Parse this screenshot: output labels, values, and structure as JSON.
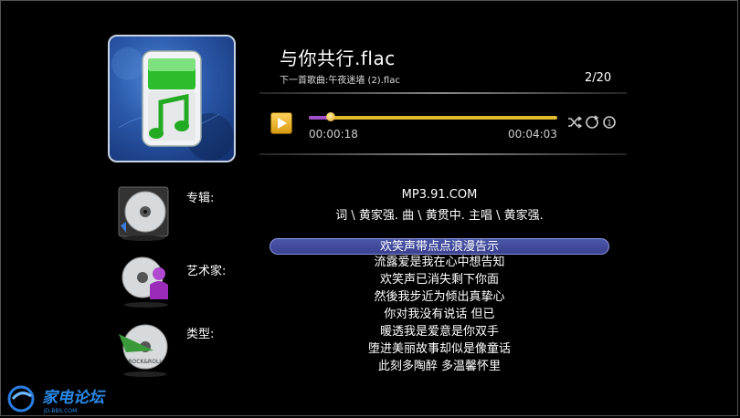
{
  "now_playing": {
    "title": "与你共行.flac",
    "next_song": "下一首歌曲:午夜迷墙  (2).flac",
    "track_position": "2/20"
  },
  "player": {
    "elapsed": "00:00:18",
    "total": "00:04:03",
    "progress_fraction": 0.09,
    "controls": [
      "play-icon",
      "shuffle-icon",
      "repeat-icon",
      "power-icon"
    ]
  },
  "info": {
    "album_label": "专辑:",
    "artist_label": "艺术家:",
    "genre_label": "类型:",
    "genre_badge": "ROCK&ROLL",
    "album_value": "MP3.91.COM",
    "credits": "词 \\ 黄家强.   曲 \\ 黄贯中.   主唱 \\ 黄家强."
  },
  "lyrics": [
    "欢笑声带点点浪漫告示",
    "流露爱是我在心中想告知",
    "欢笑声已消失剩下你面",
    "然後我步近为倾出真挚心",
    "你对我没有说话    但已",
    "暖透我是爱意是你双手",
    "堕进美丽故事却似是像童话",
    "此刻多陶醉    多温馨怀里"
  ],
  "active_lyric_index": 0,
  "watermark": {
    "text": "家电论坛",
    "subtext": "JD-BBS.COM"
  },
  "colors": {
    "background": "#000000",
    "progress_played": "#a050c8",
    "progress_remaining": "#e0bb2a",
    "active_lyric": "#4c56a8"
  }
}
